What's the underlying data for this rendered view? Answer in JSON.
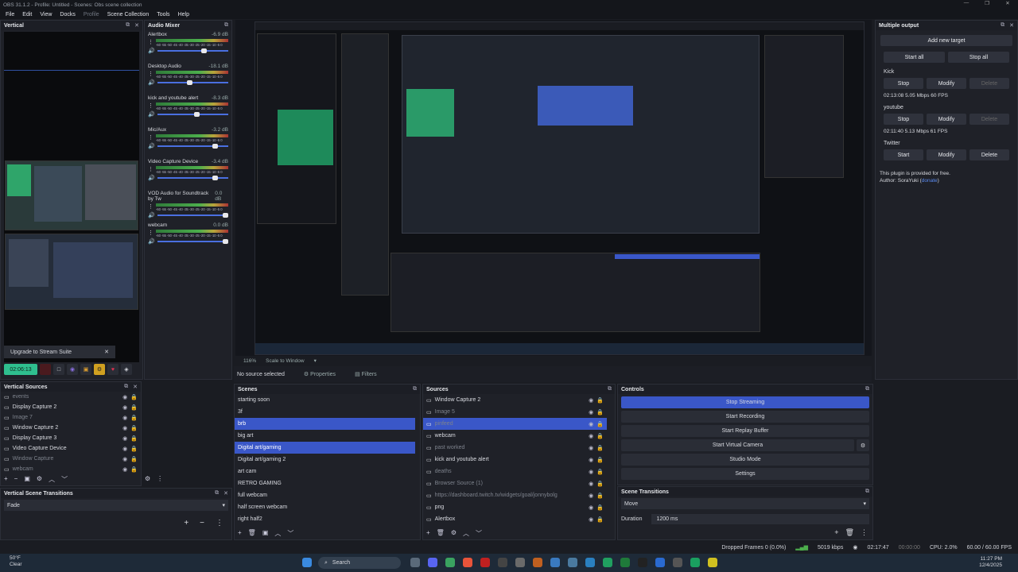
{
  "window": {
    "title": "OBS 31.1.2 - Profile: Untitled - Scenes: Obs scene collection",
    "controls": [
      "—",
      "❐",
      "✕"
    ]
  },
  "menu": [
    "File",
    "Edit",
    "View",
    "Docks",
    "Profile",
    "Scene Collection",
    "Tools",
    "Help"
  ],
  "vertical": {
    "title": "Vertical",
    "upgrade_label": "Upgrade to Stream Suite",
    "rec_time": "02:06:13"
  },
  "mixer": {
    "title": "Audio Mixer",
    "ticks": "-60 -55 -50 -45 -40 -35 -30 -25 -20 -15 -10 -5 0",
    "channels": [
      {
        "name": "Alertbox",
        "db": "-6.9 dB",
        "level": 0.7
      },
      {
        "name": "Desktop Audio",
        "db": "-18.1 dB",
        "level": 0.5
      },
      {
        "name": "kick and youtube alert",
        "db": "-8.3 dB",
        "level": 0.6
      },
      {
        "name": "Mic/Aux",
        "db": "-3.2 dB",
        "level": 0.85
      },
      {
        "name": "Video Capture Device",
        "db": "-3.4 dB",
        "level": 0.85
      },
      {
        "name": "VOD Audio for Soundtrack by Tw",
        "db": "0.0 dB",
        "level": 1.0
      },
      {
        "name": "webcam",
        "db": "0.0 dB",
        "level": 1.0
      }
    ]
  },
  "preview": {
    "zoom": "116%",
    "scale_label": "Scale to Window",
    "no_source": "No source selected",
    "properties": "Properties",
    "filters": "Filters"
  },
  "multi": {
    "title": "Multiple output",
    "add_target": "Add new target",
    "start_all": "Start all",
    "stop_all": "Stop all",
    "targets": [
      {
        "name": "Kick",
        "btn": "Stop",
        "modify": "Modify",
        "delete": "Delete",
        "stats": "02:13:08  5.05 Mbps  60 FPS",
        "active": true
      },
      {
        "name": "youtube",
        "btn": "Stop",
        "modify": "Modify",
        "delete": "Delete",
        "stats": "02:11:40  5.13 Mbps  61 FPS",
        "active": true
      },
      {
        "name": "Twitter",
        "btn": "Start",
        "modify": "Modify",
        "delete": "Delete",
        "stats": "",
        "active": false
      }
    ],
    "note": "This plugin is provided for free.",
    "author": "Author: SoraYuki (",
    "donate": "donate",
    ")": ")"
  },
  "vsources": {
    "title": "Vertical Sources",
    "items": [
      {
        "name": "events",
        "dim": true
      },
      {
        "name": "Display Capture 2",
        "dim": false
      },
      {
        "name": "Image 7",
        "dim": true
      },
      {
        "name": "Window Capture 2",
        "dim": false
      },
      {
        "name": "Display Capture 3",
        "dim": false
      },
      {
        "name": "Video Capture Device",
        "dim": false
      },
      {
        "name": "Window Capture",
        "dim": true
      },
      {
        "name": "webcam",
        "dim": true
      }
    ]
  },
  "vtrans": {
    "title": "Vertical Scene Transitions",
    "value": "Fade"
  },
  "scenes": {
    "title": "Scenes",
    "items": [
      "starting soon",
      "3f",
      "brb",
      "big art",
      "Digital art/gaming",
      "Digital art/gaming 2",
      "art cam",
      "RETRO GAMING",
      "full webcam",
      "half screen webcam",
      "right half2"
    ],
    "selected": [
      2,
      4
    ]
  },
  "sources": {
    "title": "Sources",
    "items": [
      {
        "name": "Window Capture 2",
        "dim": false
      },
      {
        "name": "Image 5",
        "dim": true
      },
      {
        "name": "pinfeed",
        "dim": true,
        "sel": true
      },
      {
        "name": "webcam",
        "dim": false
      },
      {
        "name": "past worked",
        "dim": true
      },
      {
        "name": "kick and youtube alert",
        "dim": false
      },
      {
        "name": "deaths",
        "dim": true
      },
      {
        "name": "Browser Source (1)",
        "dim": true
      },
      {
        "name": "https://dashboard.twitch.tv/widgets/goal/jonnybolg",
        "dim": true
      },
      {
        "name": "png",
        "dim": false
      },
      {
        "name": "Alertbox",
        "dim": false
      }
    ]
  },
  "controls": {
    "title": "Controls",
    "stop_streaming": "Stop Streaming",
    "start_recording": "Start Recording",
    "start_replay": "Start Replay Buffer",
    "start_vcam": "Start Virtual Camera",
    "studio_mode": "Studio Mode",
    "settings": "Settings"
  },
  "strans": {
    "title": "Scene Transitions",
    "value": "Move",
    "duration_label": "Duration",
    "duration": "1200 ms"
  },
  "status": {
    "dropped": "Dropped Frames 0 (0.0%)",
    "kbps": "5019 kbps",
    "stream_time": "02:17:47",
    "rec_time": "00:00:00",
    "cpu": "CPU: 2.0%",
    "fps": "60.00 / 60.00 FPS"
  },
  "taskbar": {
    "temp": "50°F",
    "weather": "Clear",
    "search": "Search",
    "time": "11:27 PM",
    "date": "12/4/2025"
  },
  "colors": {
    "accent": "#3a57c8",
    "stream_green": "#2fbf8f"
  }
}
